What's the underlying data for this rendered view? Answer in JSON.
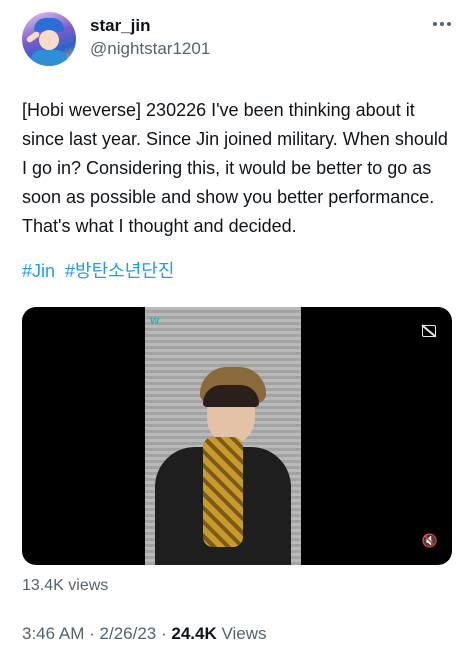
{
  "user": {
    "display_name": "star_jin",
    "handle": "@nightstar1201"
  },
  "tweet": {
    "text": "[Hobi weverse] 230226 I've been thinking about it since last year. Since Jin joined military. When should I go in? Considering this, it would be better to go as soon as possible and show you better performance. That's what I thought and decided.",
    "hashtags": [
      "#Jin",
      "#방탄소년단진"
    ]
  },
  "video": {
    "watermark": "w",
    "caption_icon": "captions-off-icon",
    "mute_icon": "mute-icon"
  },
  "stats": {
    "video_views": "13.4K views",
    "time": "3:46 AM",
    "separator": "·",
    "date": "2/26/23",
    "views_count": "24.4K",
    "views_label": "Views"
  },
  "colors": {
    "link": "#1d9bf0",
    "secondary_text": "#536471"
  }
}
